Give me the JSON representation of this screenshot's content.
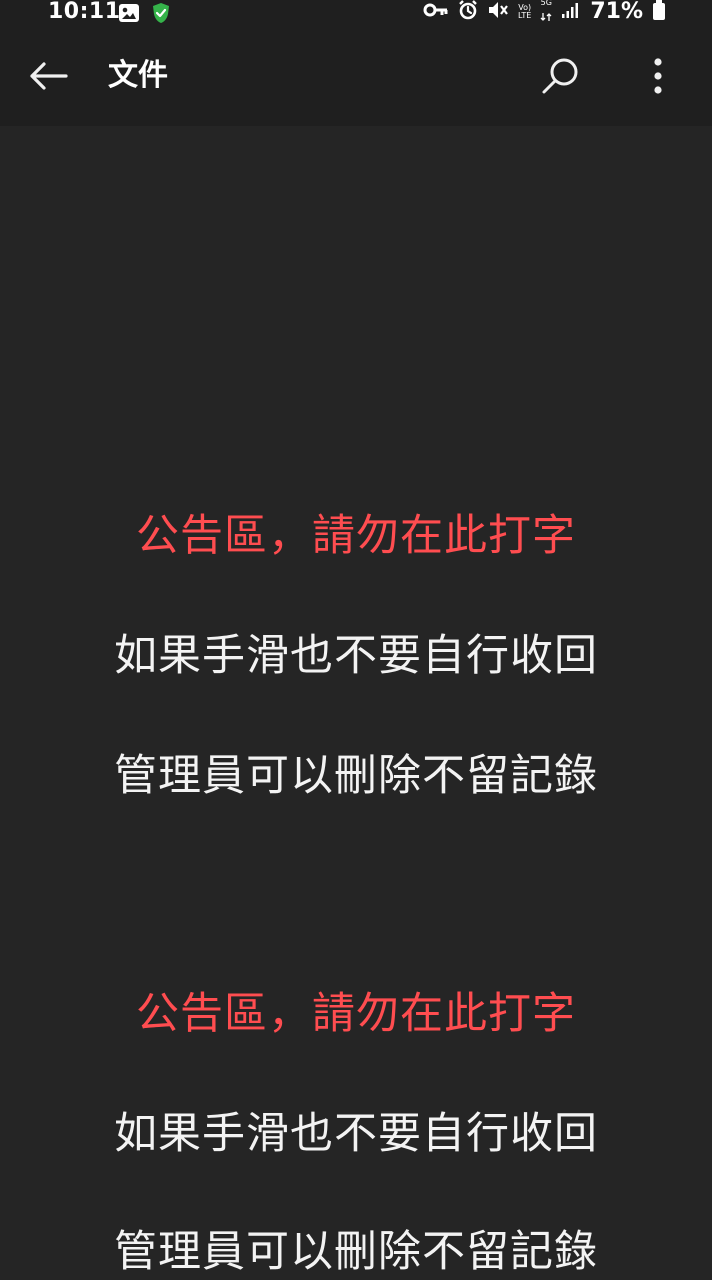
{
  "status_bar": {
    "time": "10:11",
    "battery": "71%",
    "network_top": "Vo)",
    "network_bottom": "LTE",
    "gen": "5G"
  },
  "app_bar": {
    "title": "文件",
    "back_icon": "arrow-left-icon",
    "search_icon": "search-icon",
    "more_icon": "more-vertical-icon"
  },
  "document": {
    "lines": [
      "公告區，請勿在此打字",
      "如果手滑也不要自行收回",
      "管理員可以刪除不留記錄",
      "公告區，請勿在此打字",
      "如果手滑也不要自行收回",
      "管理員可以刪除不留記錄"
    ],
    "colors": {
      "notice": "#ff4d50",
      "body": "#f3f3f3",
      "background": "#252525"
    }
  }
}
